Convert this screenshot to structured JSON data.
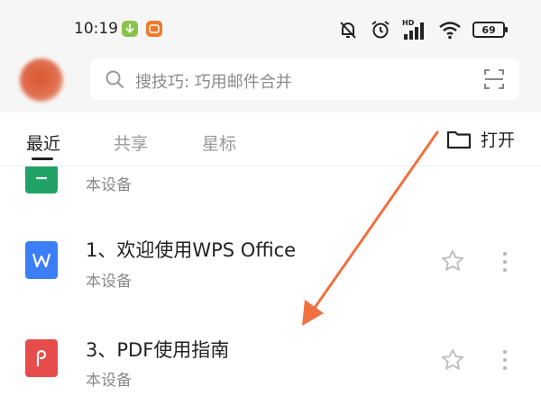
{
  "status_bar": {
    "time": "10:19",
    "battery": "69",
    "network_label": "HD"
  },
  "search": {
    "placeholder": "搜技巧: 巧用邮件合并"
  },
  "tabs": [
    {
      "label": "最近",
      "active": true
    },
    {
      "label": "共享",
      "active": false
    },
    {
      "label": "星标",
      "active": false
    }
  ],
  "open_button": {
    "label": "打开"
  },
  "files": [
    {
      "title": "",
      "subtitle": "本设备",
      "icon": "xlsx-icon",
      "color": "#21a366"
    },
    {
      "title": "1、欢迎使用WPS Office",
      "subtitle": "本设备",
      "icon": "word-icon",
      "color": "#3b7ef5"
    },
    {
      "title": "3、PDF使用指南",
      "subtitle": "本设备",
      "icon": "pdf-icon",
      "color": "#e64c4c"
    }
  ],
  "annotation": {
    "arrow_color": "#f07040"
  }
}
